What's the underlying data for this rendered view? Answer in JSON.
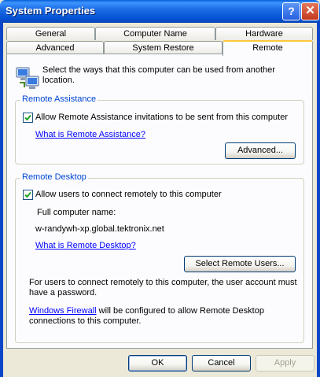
{
  "window": {
    "title": "System Properties",
    "help_icon": "?",
    "close_icon": "✕"
  },
  "tabs": {
    "row1": [
      "General",
      "Computer Name",
      "Hardware"
    ],
    "row2": [
      "Advanced",
      "System Restore",
      "Remote"
    ],
    "active": "Remote"
  },
  "intro": {
    "text": "Select the ways that this computer can be used from another location.",
    "icon": "computer-network-icon"
  },
  "remote_assistance": {
    "title": "Remote Assistance",
    "checkbox_label": "Allow Remote Assistance invitations to be sent from this computer",
    "checked": true,
    "link": "What is Remote Assistance?",
    "advanced_button": "Advanced..."
  },
  "remote_desktop": {
    "title": "Remote Desktop",
    "checkbox_label": "Allow users to connect remotely to this computer",
    "checked": true,
    "full_name_label": "Full computer name:",
    "full_name_value": "w-randywh-xp.global.tektronix.net",
    "link": "What is Remote Desktop?",
    "select_users_button": "Select Remote Users...",
    "note": "For users to connect remotely to this computer, the user account must have a password.",
    "firewall_link": "Windows Firewall",
    "firewall_text": " will be configured to allow Remote Desktop connections to this computer."
  },
  "footer": {
    "ok": "OK",
    "cancel": "Cancel",
    "apply": "Apply"
  },
  "colors": {
    "title_bar": "#0a5fd8",
    "group_title": "#0046d5",
    "link": "#0000ff",
    "active_tab_accent": "#ffc83c"
  }
}
